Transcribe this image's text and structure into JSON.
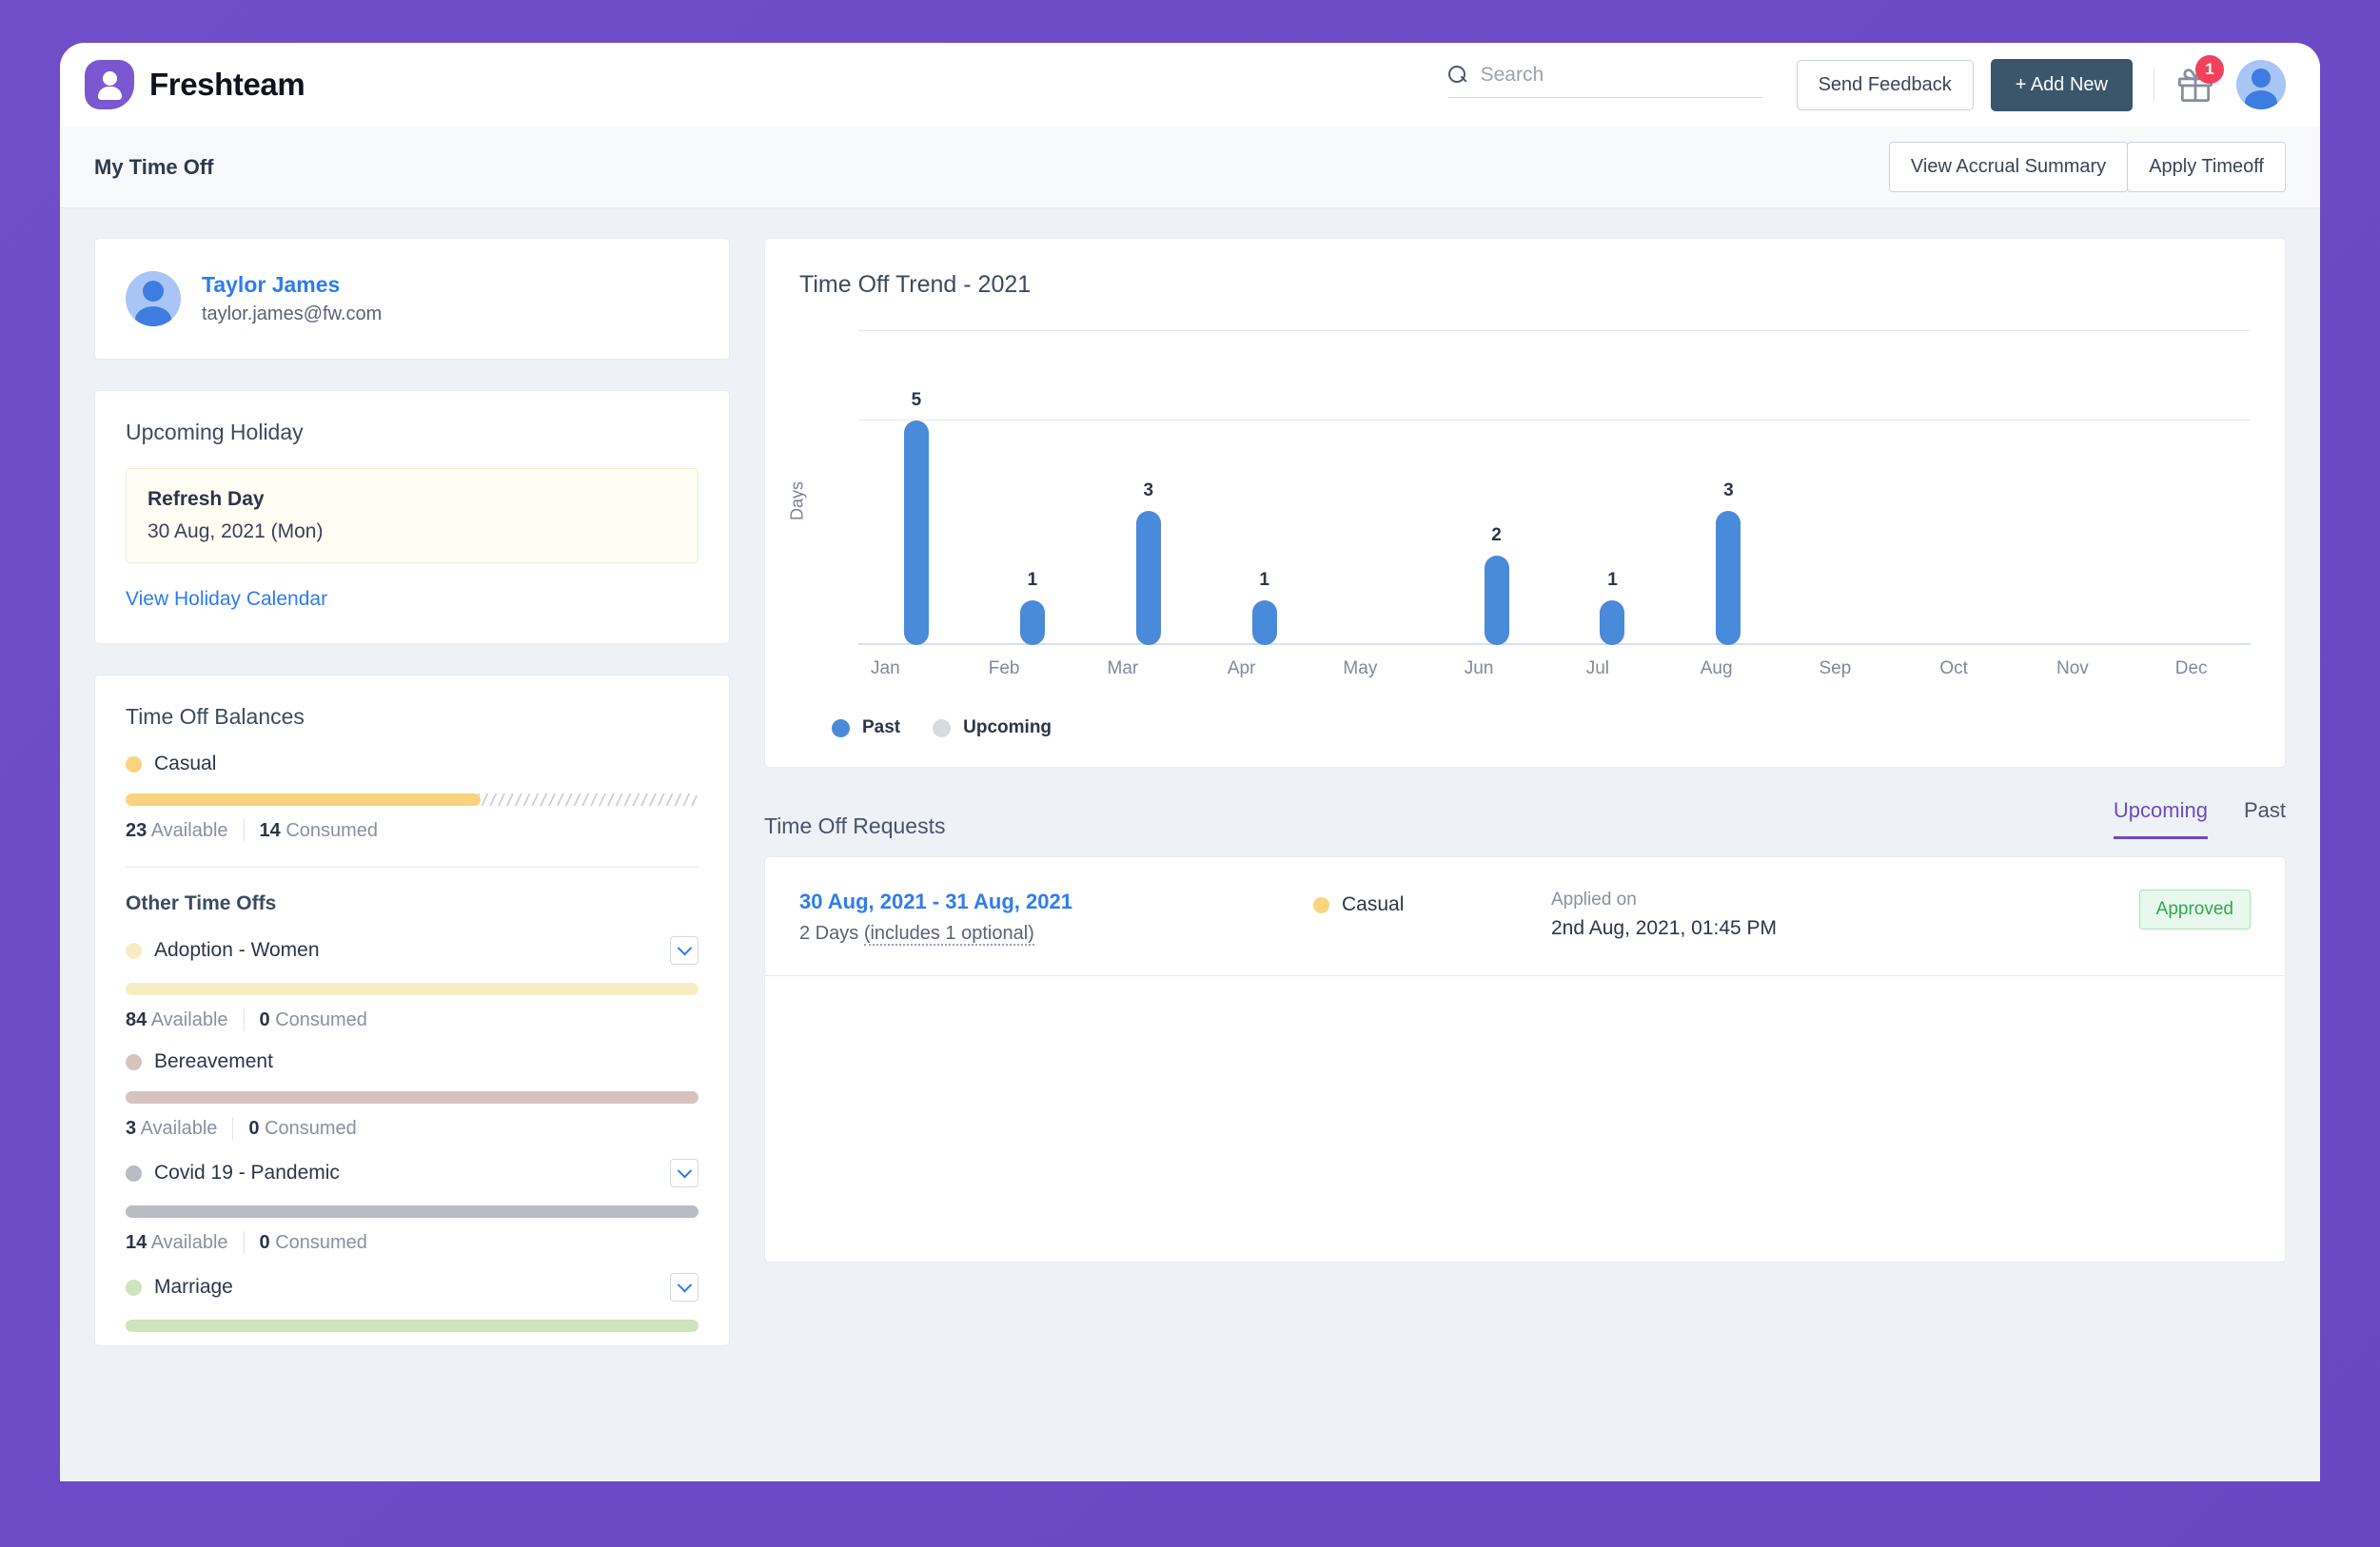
{
  "brand": {
    "name": "Freshteam",
    "logo_icon": "person-shield-icon"
  },
  "header": {
    "search_placeholder": "Search",
    "search_value": "",
    "send_feedback_label": "Send Feedback",
    "add_new_label": "+ Add New",
    "gift_badge_count": "1"
  },
  "subheader": {
    "title": "My Time Off",
    "view_accrual_label": "View Accrual Summary",
    "apply_timeoff_label": "Apply Timeoff"
  },
  "profile": {
    "name": "Taylor James",
    "email": "taylor.james@fw.com"
  },
  "holiday": {
    "title": "Upcoming Holiday",
    "name": "Refresh Day",
    "date": "30 Aug, 2021 (Mon)",
    "link_label": "View Holiday Calendar"
  },
  "balances": {
    "title": "Time Off Balances",
    "primary": {
      "label": "Casual",
      "color": "#fad37f",
      "fill_percent": 62,
      "available": "23",
      "available_label": "Available",
      "consumed": "14",
      "consumed_label": "Consumed"
    },
    "other_title": "Other Time Offs",
    "others": [
      {
        "label": "Adoption - Women",
        "color": "#f6eec0",
        "bar_color": "#f6eec0",
        "available": "84",
        "consumed": "0",
        "available_label": "Available",
        "consumed_label": "Consumed",
        "has_chevron": true
      },
      {
        "label": "Bereavement",
        "color": "#d6c3c0",
        "bar_color": "#d6c3c0",
        "available": "3",
        "consumed": "0",
        "available_label": "Available",
        "consumed_label": "Consumed",
        "has_chevron": false
      },
      {
        "label": "Covid 19 - Pandemic",
        "color": "#b9bcc2",
        "bar_color": "#b9bcc2",
        "available": "14",
        "consumed": "0",
        "available_label": "Available",
        "consumed_label": "Consumed",
        "has_chevron": true
      },
      {
        "label": "Marriage",
        "color": "#cfe3bd",
        "bar_color": "#cfe3bd",
        "available": "",
        "consumed": "",
        "available_label": "",
        "consumed_label": "",
        "has_chevron": true
      }
    ]
  },
  "chart_data": {
    "type": "bar",
    "title": "Time Off Trend - 2021",
    "xlabel": "",
    "ylabel": "Days",
    "categories": [
      "Jan",
      "Feb",
      "Mar",
      "Apr",
      "May",
      "Jun",
      "Jul",
      "Aug",
      "Sep",
      "Oct",
      "Nov",
      "Dec"
    ],
    "values": [
      5,
      1,
      3,
      1,
      0,
      2,
      1,
      3,
      0,
      0,
      0,
      0
    ],
    "ylim": [
      0,
      7
    ],
    "gridlines": [
      0,
      5,
      7
    ],
    "grid": true,
    "bar_color": "#4a8ada",
    "legend_position": "bottom-left",
    "legend": [
      {
        "name": "Past",
        "color": "#4a8ada"
      },
      {
        "name": "Upcoming",
        "color": "#d7dae1"
      }
    ]
  },
  "requests": {
    "title": "Time Off Requests",
    "tabs": [
      {
        "label": "Upcoming",
        "active": true
      },
      {
        "label": "Past",
        "active": false
      }
    ],
    "rows": [
      {
        "dates": "30 Aug, 2021  -  31 Aug, 2021",
        "duration": "2 Days ",
        "duration_note": "(includes 1 optional)",
        "type": "Casual",
        "type_color": "#fad37f",
        "applied_label": "Applied on",
        "applied_value": "2nd Aug, 2021, 01:45 PM",
        "status": "Approved"
      }
    ]
  },
  "colors": {
    "page_background": "#6b4bc4",
    "accent_purple": "#6b4bc4",
    "link_blue": "#2e7cf0",
    "chart_blue": "#4a8ada",
    "approved_green": "#2fa84f"
  }
}
